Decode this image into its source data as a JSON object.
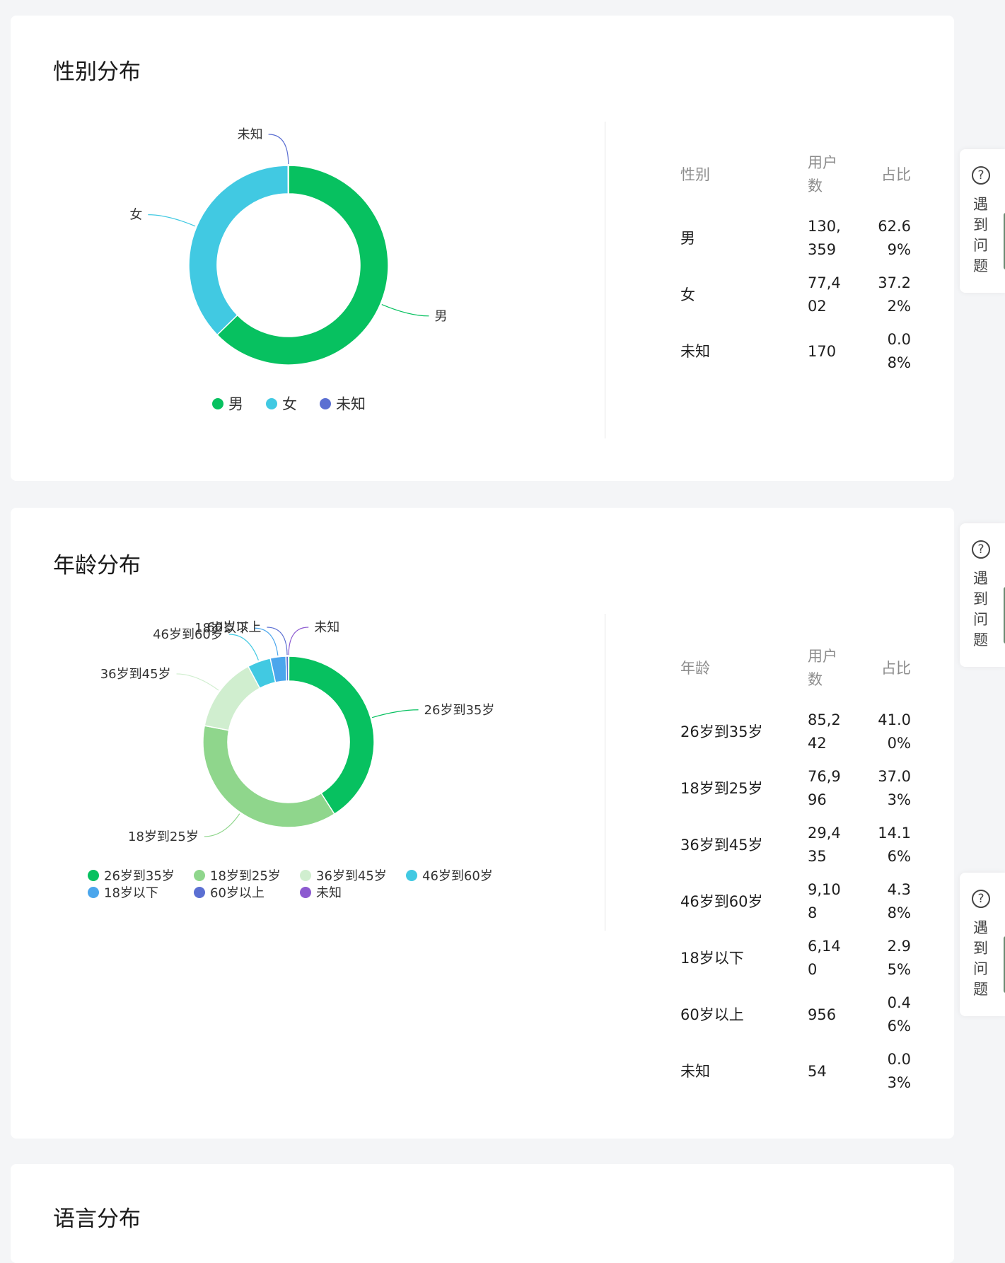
{
  "help_tab": {
    "label": "遇到问题",
    "icon": "question-circle-icon"
  },
  "colors": {
    "green": "#07c160",
    "cyan": "#41c9e2",
    "indigo": "#5b6fd2",
    "light_green": "#8fd68c",
    "pale_green": "#d0eecf",
    "blue": "#4ba6ec",
    "purple": "#8c5ad0"
  },
  "gender_section": {
    "title": "性别分布",
    "table": {
      "headers": [
        "性别",
        "用户数",
        "占比"
      ],
      "rows": [
        [
          "男",
          "130,359",
          "62.69%"
        ],
        [
          "女",
          "77,402",
          "37.22%"
        ],
        [
          "未知",
          "170",
          "0.08%"
        ]
      ]
    }
  },
  "age_section": {
    "title": "年龄分布",
    "table": {
      "headers": [
        "年龄",
        "用户数",
        "占比"
      ],
      "rows": [
        [
          "26岁到35岁",
          "85,242",
          "41.00%"
        ],
        [
          "18岁到25岁",
          "76,996",
          "37.03%"
        ],
        [
          "36岁到45岁",
          "29,435",
          "14.16%"
        ],
        [
          "46岁到60岁",
          "9,108",
          "4.38%"
        ],
        [
          "18岁以下",
          "6,140",
          "2.95%"
        ],
        [
          "60岁以上",
          "956",
          "0.46%"
        ],
        [
          "未知",
          "54",
          "0.03%"
        ]
      ]
    }
  },
  "language_section": {
    "title": "语言分布"
  },
  "chart_data": [
    {
      "type": "pie",
      "categories": [
        "男",
        "女",
        "未知"
      ],
      "values": [
        130359,
        77402,
        170
      ],
      "colors": [
        "#07c160",
        "#41c9e2",
        "#5b6fd2"
      ],
      "legend": "bottom"
    },
    {
      "type": "pie",
      "categories": [
        "26岁到35岁",
        "18岁到25岁",
        "36岁到45岁",
        "46岁到60岁",
        "18岁以下",
        "60岁以上",
        "未知"
      ],
      "values": [
        85242,
        76996,
        29435,
        9108,
        6140,
        956,
        54
      ],
      "colors": [
        "#07c160",
        "#8fd68c",
        "#d0eecf",
        "#41c9e2",
        "#4ba6ec",
        "#5b6fd2",
        "#8c5ad0"
      ],
      "legend": "bottom"
    }
  ]
}
